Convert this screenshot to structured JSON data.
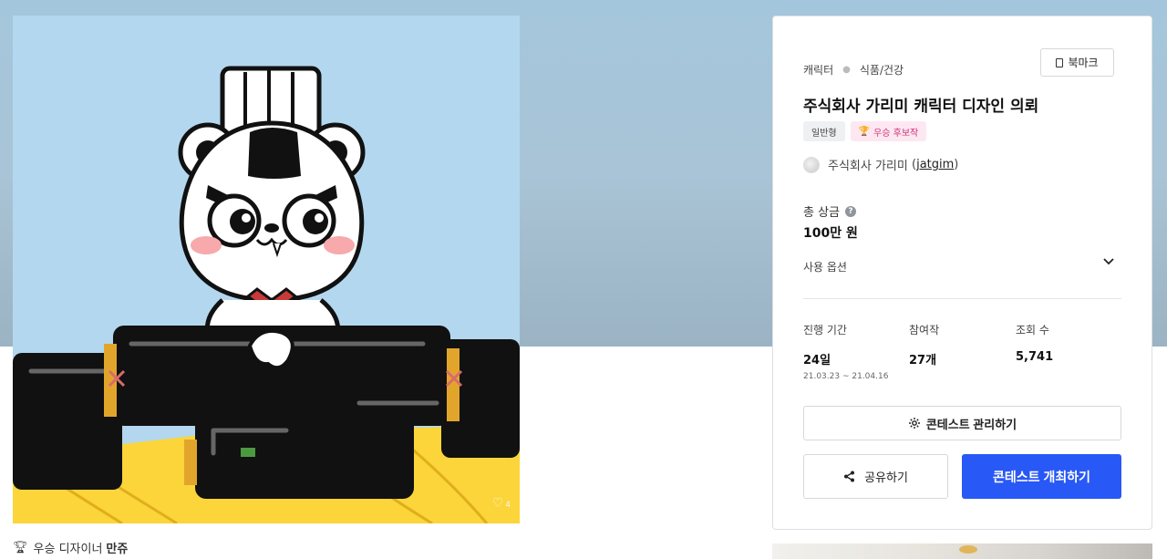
{
  "artwork": {
    "like_count": "4"
  },
  "designer": {
    "label": "우승 디자이너",
    "name": "만쥬"
  },
  "panel": {
    "breadcrumb": {
      "category": "캐릭터",
      "subcategory": "식품/건강"
    },
    "bookmark_label": "북마크",
    "title": "주식회사 가리미 캐릭터 디자인 의뢰",
    "badges": {
      "type": "일반형",
      "award": "우승 후보작",
      "award_icon": "🏆"
    },
    "owner": {
      "name": "주식회사 가리미",
      "handle": "jatgim"
    },
    "prize": {
      "label": "총 상금",
      "value": "100만 원"
    },
    "usage_label": "사용 옵션",
    "stats": {
      "period": {
        "label": "진행 기간",
        "value": "24일",
        "range": "21.03.23 ~ 21.04.16"
      },
      "entries": {
        "label": "참여작",
        "value": "27개"
      },
      "views": {
        "label": "조회 수",
        "value": "5,741"
      }
    },
    "buttons": {
      "manage": "콘테스트 관리하기",
      "share": "공유하기",
      "host": "콘테스트 개최하기"
    }
  },
  "colors": {
    "primary": "#2858f6",
    "award": "#d2307a",
    "hero": "#a4c6dc"
  }
}
